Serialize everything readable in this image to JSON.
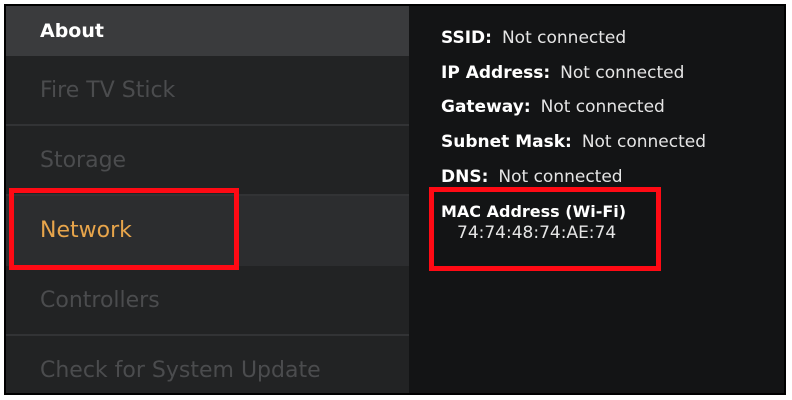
{
  "sidebar": {
    "header": "About",
    "items": [
      {
        "label": "Fire TV Stick"
      },
      {
        "label": "Storage"
      },
      {
        "label": "Network"
      },
      {
        "label": "Controllers"
      },
      {
        "label": "Check for System Update"
      }
    ],
    "selected_item": "Network"
  },
  "network": {
    "ssid_label": "SSID:",
    "ssid_value": "Not connected",
    "ip_label": "IP Address:",
    "ip_value": "Not connected",
    "gateway_label": "Gateway:",
    "gateway_value": "Not connected",
    "subnet_label": "Subnet Mask:",
    "subnet_value": "Not connected",
    "dns_label": "DNS:",
    "dns_value": "Not connected",
    "mac_label": "MAC Address (Wi-Fi)",
    "mac_value": "74:74:48:74:AE:74"
  },
  "colors": {
    "accent_selected": "#e8a54b",
    "highlight_box": "#ff0a14"
  }
}
